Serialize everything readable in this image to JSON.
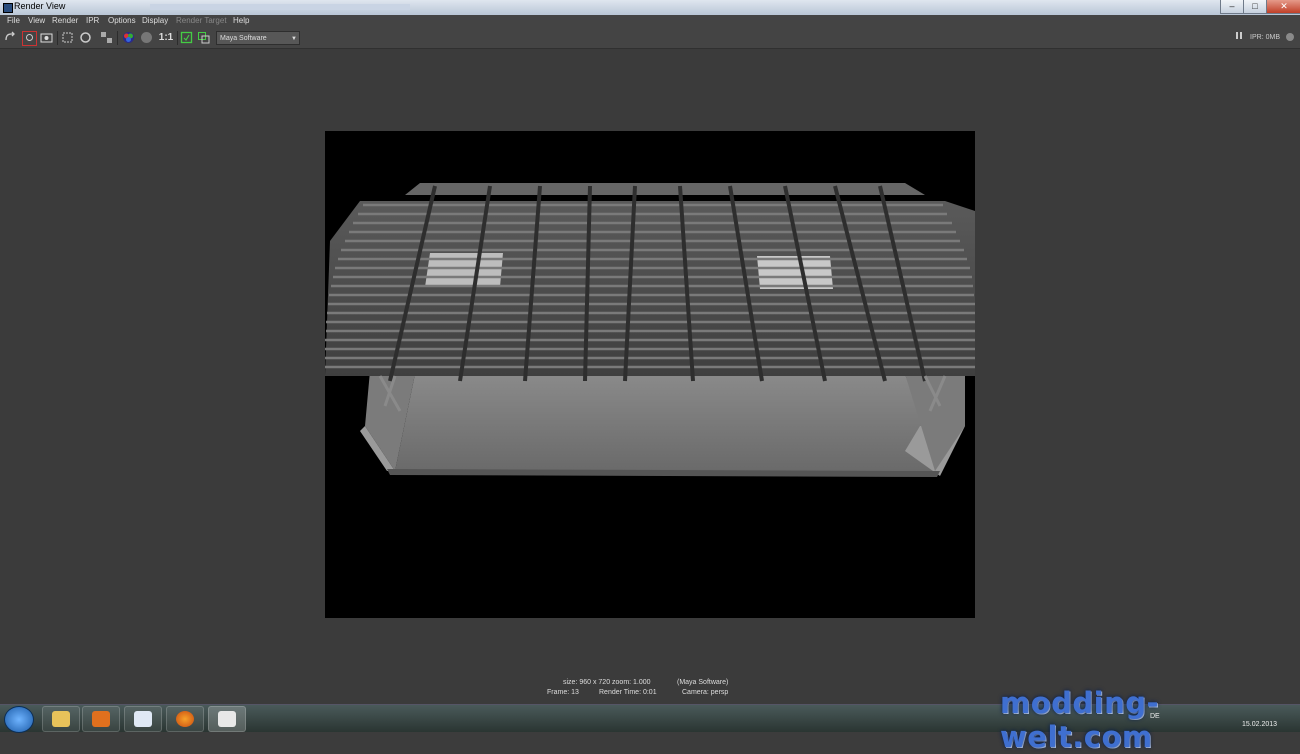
{
  "window": {
    "title": "Render View"
  },
  "window_controls": {
    "minimize": "–",
    "maximize": "□",
    "close": "✕"
  },
  "menu": [
    "File",
    "View",
    "Render",
    "IPR",
    "Options",
    "Display",
    "Render Target",
    "Help"
  ],
  "toolbar": {
    "zoom_label": "1:1",
    "renderer": "Maya Software",
    "ipr_status": "IPR: 0MB",
    "icons": [
      "redo-render-icon",
      "ipr-render-icon",
      "snapshot-icon",
      "render-region-icon",
      "refresh-ipr-icon",
      "snapshot-region-icon",
      "display-rgb-icon",
      "display-alpha-icon",
      "zoom-1-1-icon",
      "keep-image-icon",
      "remove-image-icon"
    ]
  },
  "render_info": {
    "line1_size": "size: 960 x 720 zoom: 1.000",
    "line1_renderer": "(Maya Software)",
    "line2_frame": "Frame: 13",
    "line2_time": "Render Time: 0:01",
    "line2_camera": "Camera: persp"
  },
  "render_image": {
    "subject": "slatted wooden roof structure with two skylight openings over a rectangular floor"
  },
  "taskbar": {
    "apps": [
      "windows-explorer-icon",
      "media-player-icon",
      "image-editor-icon",
      "firefox-icon",
      "maya-icon"
    ],
    "tray_lang": "DE",
    "date": "15.02.2013"
  },
  "watermark": "modding-welt.com",
  "colors": {
    "viewport_bg": "#3b3b3b",
    "render_bg": "#000000",
    "accent": "#3f6fd0"
  }
}
